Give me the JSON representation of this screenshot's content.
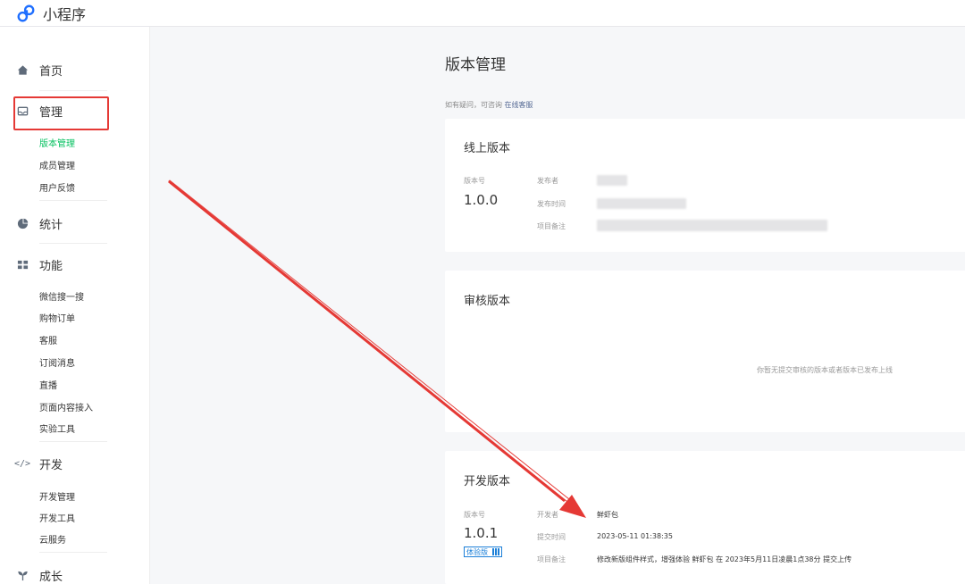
{
  "app": {
    "title": "小程序"
  },
  "sidebar": {
    "home": "首页",
    "manage": "管理",
    "manage_items": [
      "版本管理",
      "成员管理",
      "用户反馈"
    ],
    "stats": "统计",
    "features": "功能",
    "feature_items": [
      "微信搜一搜",
      "购物订单",
      "客服",
      "订阅消息",
      "直播",
      "页面内容接入",
      "实验工具"
    ],
    "dev": "开发",
    "dev_items": [
      "开发管理",
      "开发工具",
      "云服务"
    ],
    "growth": "成长"
  },
  "main": {
    "title": "版本管理",
    "hint_prefix": "如有疑问，可咨询",
    "hint_link": "在线客服",
    "online": {
      "title": "线上版本",
      "version_label": "版本号",
      "version": "1.0.0",
      "publisher_label": "发布者",
      "publish_time_label": "发布时间",
      "remark_label": "项目备注"
    },
    "review": {
      "title": "审核版本",
      "empty": "你暂无提交审核的版本或者版本已发布上线"
    },
    "dev": {
      "title": "开发版本",
      "version_label": "版本号",
      "version": "1.0.1",
      "badge": "体验版",
      "developer_label": "开发者",
      "developer": "鲜虾包",
      "submit_time_label": "提交时间",
      "submit_time": "2023-05-11 01:38:35",
      "remark_label": "项目备注",
      "remark": "修改新版组件样式，增强体验 鲜虾包 在 2023年5月11日凌晨1点38分 提交上传"
    }
  },
  "colors": {
    "accent_green": "#07c160",
    "link_blue": "#576b95",
    "annotation_red": "#e53935"
  }
}
